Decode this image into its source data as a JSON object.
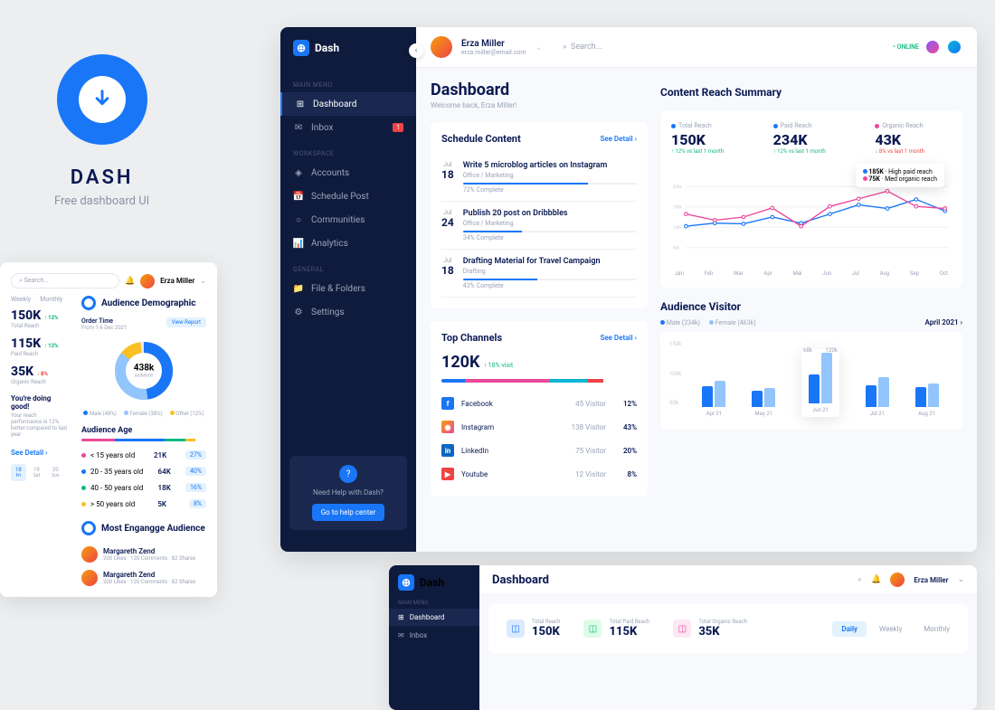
{
  "promo": {
    "title": "DASH",
    "subtitle": "Free dashboard UI"
  },
  "app": {
    "brand": "Dash",
    "user": {
      "name": "Erza Miller",
      "email": "erza.miller@email.com"
    },
    "search_placeholder": "Search...",
    "online": "• ONLINE",
    "sidebar": {
      "sections": [
        "MAIN MENU",
        "Workspace",
        "General"
      ],
      "items": [
        {
          "icon": "⊞",
          "label": "Dashboard",
          "active": true
        },
        {
          "icon": "✉",
          "label": "Inbox",
          "badge": "1"
        },
        {
          "icon": "◈",
          "label": "Accounts"
        },
        {
          "icon": "📅",
          "label": "Schedule Post"
        },
        {
          "icon": "○",
          "label": "Communities"
        },
        {
          "icon": "📊",
          "label": "Analytics"
        },
        {
          "icon": "📁",
          "label": "File & Folders"
        },
        {
          "icon": "⚙",
          "label": "Settings"
        }
      ],
      "help": {
        "text": "Need Help with Dash?",
        "button": "Go to help center"
      }
    },
    "header": {
      "title": "Dashboard",
      "subtitle": "Welcome back, Erza Miller!"
    },
    "schedule": {
      "title": "Schedule Content",
      "detail": "See Detail",
      "items": [
        {
          "month": "Jul",
          "day": "18",
          "title": "Write 5 microblog articles on Instagram",
          "meta": "Office / Marketing",
          "progress": "72% Complete",
          "pct": 72
        },
        {
          "month": "Jul",
          "day": "24",
          "title": "Publish 20 post on Dribbbles",
          "meta": "Office / Marketing",
          "progress": "34% Complete",
          "pct": 34
        },
        {
          "month": "Jul",
          "day": "18",
          "title": "Drafting Material for Travel Campaign",
          "meta": "Drafting",
          "progress": "43% Complete",
          "pct": 43
        }
      ]
    },
    "reach": {
      "title": "Content Reach Summary",
      "metrics": [
        {
          "dot": "#1976f7",
          "label": "Total Reach",
          "value": "150K",
          "change": "↑ 12% vs last 1 month",
          "pos": true
        },
        {
          "dot": "#1976f7",
          "label": "Paid Reach",
          "value": "234K",
          "change": "↑ 12% vs last 1 month",
          "pos": true
        },
        {
          "dot": "#ec4899",
          "label": "Organic Reach",
          "value": "43K",
          "change": "↓ 8% vs last 1 month",
          "pos": false
        }
      ],
      "tooltip": {
        "items": [
          {
            "k": "185K",
            "v": "High paid reach",
            "c": "#1976f7"
          },
          {
            "k": "75K",
            "v": "Med organic reach",
            "c": "#ec4899"
          }
        ]
      }
    },
    "channels": {
      "title": "Top Channels",
      "detail": "See Detail",
      "value": "120K",
      "change": "↑ 18% visit",
      "list": [
        {
          "name": "Facebook",
          "visits": "45 Visitor",
          "pct": "12%",
          "color": "#1976f7",
          "letter": "f"
        },
        {
          "name": "Instagram",
          "visits": "138 Visitor",
          "pct": "43%",
          "color": "linear-gradient(135deg,#f59e0b,#ec4899)",
          "letter": "◉"
        },
        {
          "name": "LinkedIn",
          "visits": "75 Visitor",
          "pct": "20%",
          "color": "#0a66c2",
          "letter": "in"
        },
        {
          "name": "Youtube",
          "visits": "12 Visitor",
          "pct": "8%",
          "color": "#ef4444",
          "letter": "▶"
        }
      ],
      "bars": [
        {
          "c": "#1976f7",
          "w": 12
        },
        {
          "c": "#ec4899",
          "w": 43
        },
        {
          "c": "#06b6d4",
          "w": 20
        },
        {
          "c": "#ef4444",
          "w": 8
        }
      ]
    },
    "audience": {
      "title": "Audience Visitor",
      "legend": [
        {
          "c": "#1976f7",
          "t": "Male (234k)"
        },
        {
          "c": "#93c5fd",
          "t": "Female (463k)"
        }
      ],
      "period": "April 2021 ›",
      "months": [
        "Apr 21",
        "May 21",
        "Jun 21",
        "Jul 21",
        "Aug 21"
      ],
      "highlight": {
        "month": "Jun 21",
        "m": "68k",
        "f": "120k"
      }
    }
  },
  "chart_data": {
    "reach_lines": {
      "type": "line",
      "x": [
        "Jan",
        "Feb",
        "Mar",
        "Apr",
        "Mai",
        "Jun",
        "Jul",
        "Aug",
        "Sep",
        "Oct"
      ],
      "ylim": [
        0,
        200
      ],
      "yticks": [
        "200k",
        "150k",
        "100k",
        "50k"
      ],
      "series": [
        {
          "name": "High paid reach",
          "color": "#1976f7",
          "values": [
            70,
            80,
            78,
            100,
            80,
            110,
            140,
            128,
            158,
            120
          ]
        },
        {
          "name": "Med organic reach",
          "color": "#ec4899",
          "values": [
            110,
            90,
            100,
            130,
            70,
            135,
            160,
            185,
            135,
            128
          ]
        }
      ]
    },
    "audience_bars": {
      "type": "bar",
      "categories": [
        "Apr 21",
        "May 21",
        "Jun 21",
        "Jul 21",
        "Aug 21"
      ],
      "ylim": [
        0,
        150
      ],
      "yticks": [
        "150k",
        "100k",
        "50k"
      ],
      "series": [
        {
          "name": "Male",
          "color": "#1976f7",
          "values": [
            50,
            38,
            68,
            52,
            48
          ]
        },
        {
          "name": "Female",
          "color": "#93c5fd",
          "values": [
            62,
            44,
            120,
            70,
            55
          ]
        }
      ]
    },
    "demographic_donut": {
      "type": "pie",
      "center": "438k",
      "unit": "audience",
      "segments": [
        {
          "name": "Male",
          "pct": 48,
          "color": "#1976f7"
        },
        {
          "name": "Female",
          "pct": 38,
          "color": "#93c5fd"
        },
        {
          "name": "Other",
          "pct": 12,
          "color": "#fbbf24"
        }
      ]
    }
  },
  "peek_left": {
    "search": "Search...",
    "user": "Erza Miller",
    "tabs": [
      "Weekly",
      "Monthly"
    ],
    "reach": [
      {
        "v": "150K",
        "l": "Total Reach",
        "c": "↑ 12%"
      },
      {
        "v": "115K",
        "l": "Paid Reach",
        "c": "↑ 12%"
      },
      {
        "v": "35K",
        "l": "Organic Reach",
        "c": "↓ 8%"
      }
    ],
    "doing": "You're doing good!",
    "doing_sub": "Your reach performance is 12% better compared to last year",
    "demo_title": "Audience Demographic",
    "order": "Order Time",
    "order_sub": "From 1-6 Dec 2021",
    "report": "View Report",
    "donut_legend": [
      {
        "t": "Male (48%)",
        "c": "#1976f7"
      },
      {
        "t": "Female (38%)",
        "c": "#93c5fd"
      },
      {
        "t": "Other (12%)",
        "c": "#fbbf24"
      }
    ],
    "age_title": "Audience Age",
    "ages": [
      {
        "c": "#ec4899",
        "label": "< 15 years old",
        "v": "21K",
        "p": "27%"
      },
      {
        "c": "#1976f7",
        "label": "20 - 35 years old",
        "v": "64K",
        "p": "40%"
      },
      {
        "c": "#10b981",
        "label": "40 - 50 years old",
        "v": "18K",
        "p": "16%"
      },
      {
        "c": "#fbbf24",
        "label": "> 50 years old",
        "v": "5K",
        "p": "8%"
      }
    ],
    "engage": "Most Engangge Audience",
    "eng_list": [
      {
        "n": "Margareth Zend",
        "s": "200 Likes · 120 Comments · 82 Shares"
      },
      {
        "n": "Margareth Zend",
        "s": "200 Likes · 120 Comments · 82 Shares"
      }
    ],
    "detail": "See Detail",
    "days": [
      "Fri",
      "Sat",
      "Sun"
    ],
    "nums": [
      "18",
      "19",
      "20"
    ]
  },
  "peek_bottom": {
    "brand": "Dash",
    "title": "Dashboard",
    "user": "Erza Miller",
    "menu": [
      "Dashboard",
      "Inbox"
    ],
    "section": "MAIN MENU",
    "stats": [
      {
        "c": "#dbeafe",
        "ic": "#1976f7",
        "l": "Total Reach",
        "v": "150K"
      },
      {
        "c": "#dcfce7",
        "ic": "#10b981",
        "l": "Total Paid Reach",
        "v": "115K"
      },
      {
        "c": "#fce7f3",
        "ic": "#ec4899",
        "l": "Total Organic Reach",
        "v": "35K"
      }
    ],
    "tabs": [
      "Daily",
      "Weekly",
      "Monthly"
    ]
  }
}
